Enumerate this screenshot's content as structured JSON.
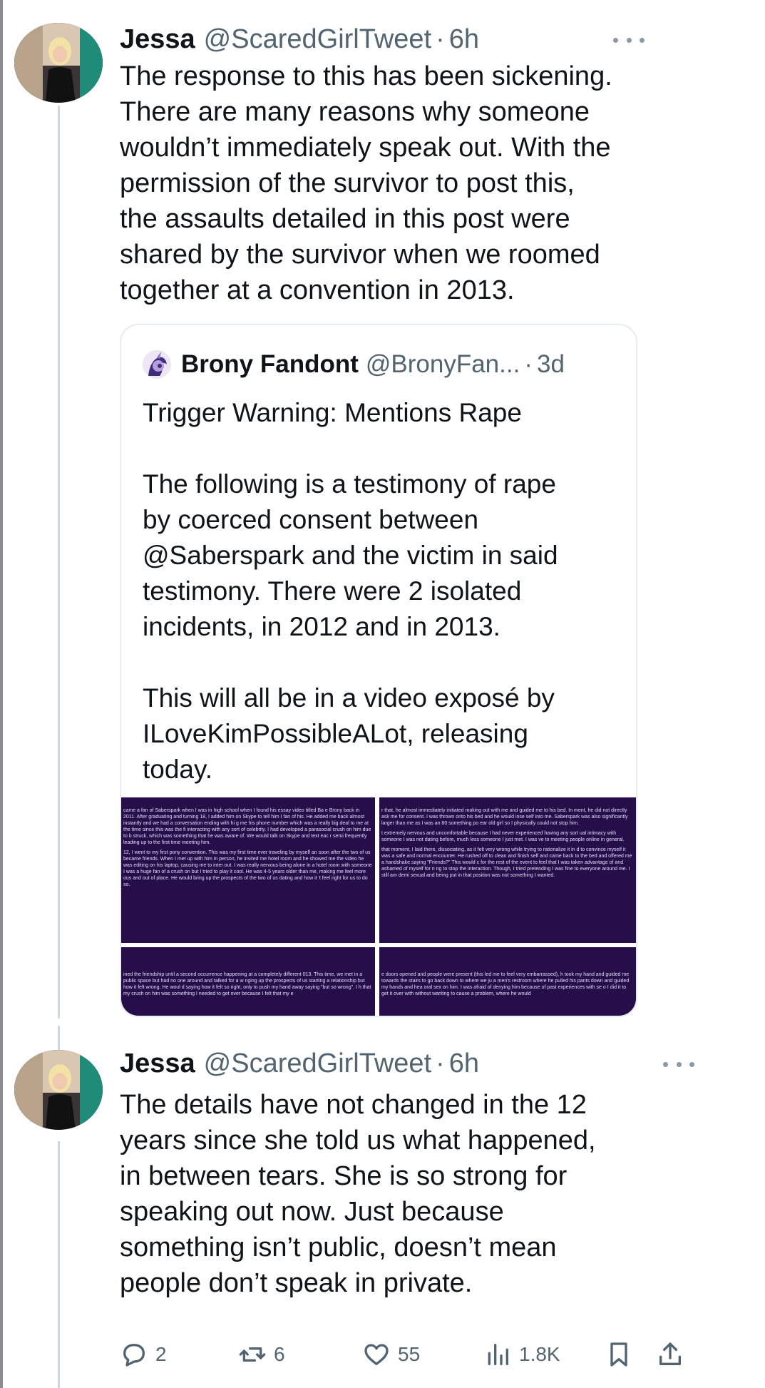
{
  "tweet1": {
    "name": "Jessa",
    "handle": "@ScaredGirlTweet",
    "separator": "·",
    "time": "6h",
    "text": "The response to this has been sickening.\nThere are many reasons why someone\nwouldn’t immediately speak out. With the\npermission of the survivor to post this,\nthe assaults detailed in this post were\nshared by the survivor when we roomed\ntogether at a convention in 2013."
  },
  "quote": {
    "name": "Brony Fandont",
    "handle": "@BronyFan...",
    "separator": "·",
    "time": "3d",
    "text": "Trigger Warning: Mentions Rape\n\nThe following is a testimony of rape\nby coerced consent between\n@Saberspark and the victim in said\ntestimony. There were 2 isolated\nincidents, in 2012 and in 2013.\n\nThis will all be in a video exposé by\nILoveKimPossibleALot, releasing\ntoday.",
    "images": [
      {
        "p1": "came a fan of Saberspark when I was in high school when I found his essay video titled Ba e Brony back in 2011. After graduating and turning 18, I added him on Skype to tell him I fan of his. He added me back almost instantly and we had a conversation ending with hi g me his phone number which was a really big deal to me at the time since this was the fi interacting with any sort of celebrity. I had developed a parasocial crush on him due to b struck, which was something that he was aware of. We would talk on Skype and text eac r semi frequently leading up to the first time meeting him.",
        "p2": "12, I went to my first pony convention. This was my first time ever traveling by myself an soon after the two of us became friends. When I met up with him in person, he invited me hotel room and he showed me the video he was editing on his laptop, causing me to inter out. I was really nervous being alone in a hotel room with someone I was a huge fan of a crush on but I tried to play it cool. He was 4-5 years older than me, making me feel more ous and out of place. He would bring up the prospects of the two of us dating and how it 't feel right for us to do so."
      },
      {
        "p1": "r that, he almost immediately initiated making out with me and guided me to his bed. In ment, he did not directly ask me for consent. I was thrown onto his bed and he would inse self into me. Saberspark was also significantly larger than me as I was an 80 something po ear old girl so I physically could not stop him.",
        "p2": "t extremely nervous and uncomfortable because I had never experienced having any sort ual intimacy with someone I was not dating before, much less someone I just met. I was ve to meeting people online in general.",
        "p3": "that moment, I laid there, dissociating, as it felt very wrong while trying to rationalize it in d to convince myself it was a safe and normal encounter. He rushed off to clean and finish self and came back to the bed and offered me a handshake saying \"Friends?\" This would c for the rest of the event to feel that I was taken advantage of and ashamed of myself for n ng to stop the interaction. Though, I tried pretending I was fine to everyone around me. I still am demi sexual and being put in that position was not something I wanted."
      },
      {
        "p1": "ined the friendship until a second occurrence happening at a completely different 013. This time, we met in a public space but had no one around and talked for a w nging up the prospects of us starting a relationship but how it felt wrong. He woul d saying how it felt so right, only to push my hand away saying \"but so wrong\". I h that my crush on him was something I needed to get over because I felt that my e"
      },
      {
        "p1": "e doors opened and people were present (this led me to feel very embarrassed), h took my hand and guided me towards the stairs to go back down to where we ju a men's restroom where he pulled his pants down and guided my hands and hea oral sex on him. I was afraid of denying him because of past experiences with se o I did it to get it over with without wanting to cause a problem, where he would"
      }
    ]
  },
  "tweet2": {
    "name": "Jessa",
    "handle": "@ScaredGirlTweet",
    "separator": "·",
    "time": "6h",
    "text": "The details have not changed in the 12\nyears since she told us what happened,\nin between tears. She is so strong for\nspeaking out now. Just because\nsomething isn’t public, doesn’t mean\npeople don’t speak in private."
  },
  "actions": {
    "replies": "2",
    "reposts": "6",
    "likes": "55",
    "views": "1.8K"
  },
  "icons": {
    "more": "more-icon",
    "reply": "reply-icon",
    "repost": "repost-icon",
    "like": "heart-icon",
    "views": "views-icon",
    "bookmark": "bookmark-icon",
    "share": "share-icon"
  },
  "colors": {
    "text": "#0f1419",
    "secondary": "#536471",
    "border": "#e7ecf0",
    "image_background": "#250e4a"
  }
}
